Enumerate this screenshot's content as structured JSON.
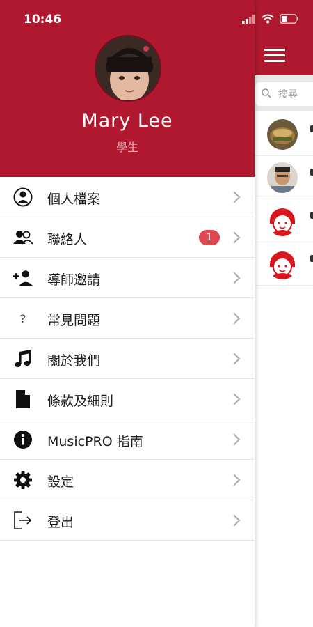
{
  "status_bar": {
    "time": "10:46"
  },
  "profile": {
    "name": "Mary Lee",
    "role": "學生"
  },
  "menu": {
    "items": [
      {
        "label": "個人檔案",
        "icon": "person-circle-icon"
      },
      {
        "label": "聯絡人",
        "icon": "contacts-icon",
        "badge": "1"
      },
      {
        "label": "導師邀請",
        "icon": "add-person-icon"
      },
      {
        "label": "常見問題",
        "icon": "question-icon"
      },
      {
        "label": "關於我們",
        "icon": "music-note-icon"
      },
      {
        "label": "條款及細則",
        "icon": "document-icon"
      },
      {
        "label": "MusicPRO 指南",
        "icon": "info-icon"
      },
      {
        "label": "設定",
        "icon": "gear-icon"
      },
      {
        "label": "登出",
        "icon": "logout-icon"
      }
    ]
  },
  "main": {
    "search_placeholder": "搜尋"
  },
  "colors": {
    "brand": "#b0182f",
    "badge": "#e0464e",
    "role_text": "#f0b3bb"
  }
}
